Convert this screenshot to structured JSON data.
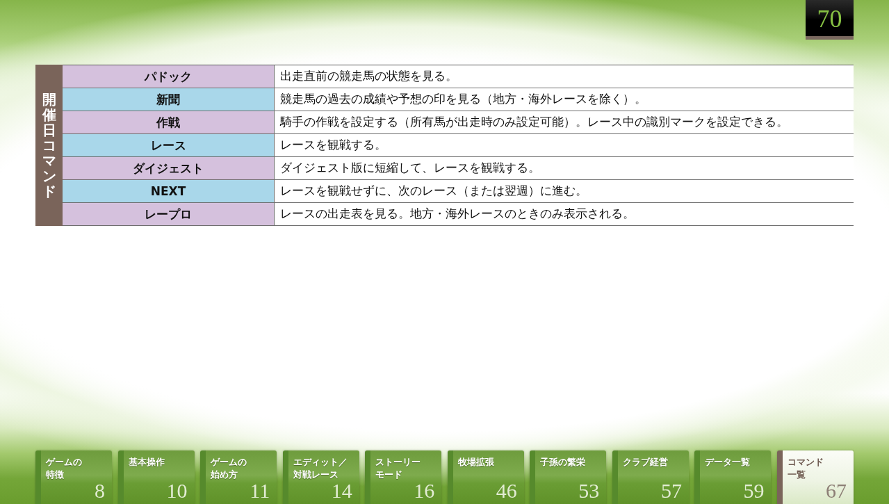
{
  "page_number": "70",
  "section": {
    "title": "開催日コマンド",
    "rows": [
      {
        "command": "パドック",
        "description": "出走直前の競走馬の状態を見る。"
      },
      {
        "command": "新聞",
        "description": "競走馬の過去の成績や予想の印を見る（地方・海外レースを除く）。"
      },
      {
        "command": "作戦",
        "description": "騎手の作戦を設定する（所有馬が出走時のみ設定可能）。レース中の識別マークを設定できる。"
      },
      {
        "command": "レース",
        "description": "レースを観戦する。"
      },
      {
        "command": "ダイジェスト",
        "description": "ダイジェスト版に短縮して、レースを観戦する。"
      },
      {
        "command": "NEXT",
        "description": "レースを観戦せずに、次のレース（または翌週）に進む。"
      },
      {
        "command": "レープロ",
        "description": "レースの出走表を見る。地方・海外レースのときのみ表示される。"
      }
    ]
  },
  "tabs": [
    {
      "label_lines": [
        "ゲームの",
        "特徴"
      ],
      "page": "8",
      "selected": false
    },
    {
      "label_lines": [
        "基本操作"
      ],
      "page": "10",
      "selected": false
    },
    {
      "label_lines": [
        "ゲームの",
        "始め方"
      ],
      "page": "11",
      "selected": false
    },
    {
      "label_lines": [
        "エディット／",
        "対戦レース"
      ],
      "page": "14",
      "selected": false
    },
    {
      "label_lines": [
        "ストーリー",
        "モード"
      ],
      "page": "16",
      "selected": false
    },
    {
      "label_lines": [
        "牧場拡張"
      ],
      "page": "46",
      "selected": false
    },
    {
      "label_lines": [
        "子孫の繁栄"
      ],
      "page": "53",
      "selected": false
    },
    {
      "label_lines": [
        "クラブ経営"
      ],
      "page": "57",
      "selected": false
    },
    {
      "label_lines": [
        "データ一覧"
      ],
      "page": "59",
      "selected": false
    },
    {
      "label_lines": [
        "コマンド",
        "一覧"
      ],
      "page": "67",
      "selected": true
    }
  ]
}
